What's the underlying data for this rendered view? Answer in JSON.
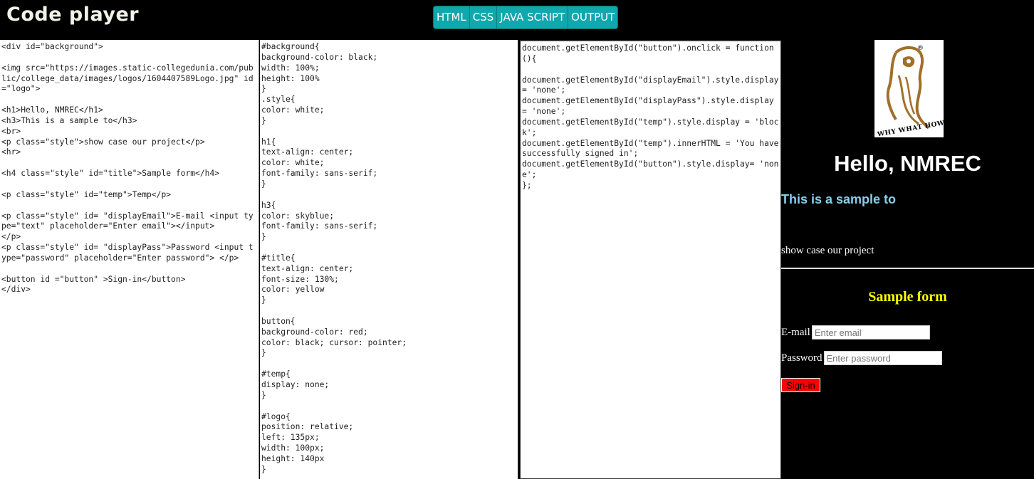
{
  "app": {
    "title": "Code player"
  },
  "tabs": [
    {
      "label": "HTML"
    },
    {
      "label": "CSS"
    },
    {
      "label": "JAVA SCRIPT"
    },
    {
      "label": "OUTPUT"
    }
  ],
  "editors": {
    "html": "<div id=\"background\">\n\n<img src=\"https://images.static-collegedunia.com/public/college_data/images/logos/1604407589Logo.jpg\" id=\"logo\">\n\n<h1>Hello, NMREC</h1>\n<h3>This is a sample to</h3>\n<br>\n<p class=\"style\">show case our project</p>\n<hr>\n\n<h4 class=\"style\" id=\"title\">Sample form</h4>\n\n<p class=\"style\" id=\"temp\">Temp</p>\n\n<p class=\"style\" id= \"displayEmail\">E-mail <input type=\"text\" placeholder=\"Enter email\"></input>\n</p>\n<p class=\"style\" id= \"displayPass\">Password <input type=\"password\" placeholder=\"Enter password\"> </p>\n\n<button id =\"button\" >Sign-in</button>\n</div>",
    "css": "#background{\nbackground-color: black;\nwidth: 100%;\nheight: 100%\n}\n.style{\ncolor: white;\n}\n\nh1{\ntext-align: center;\ncolor: white;\nfont-family: sans-serif;\n}\n\nh3{\ncolor: skyblue;\nfont-family: sans-serif;\n}\n\n#title{\ntext-align: center;\nfont-size: 130%;\ncolor: yellow\n}\n\nbutton{\nbackground-color: red;\ncolor: black; cursor: pointer;\n}\n\n#temp{\ndisplay: none;\n}\n\n#logo{\nposition: relative;\nleft: 135px;\nwidth: 100px;\nheight: 140px\n}",
    "js": "document.getElementById(\"button\").onclick = function(){\n\ndocument.getElementById(\"displayEmail\").style.display = 'none';\ndocument.getElementById(\"displayPass\").style.display = 'none';\ndocument.getElementById(\"temp\").style.display = 'block';\ndocument.getElementById(\"temp\").innerHTML = 'You have successfully signed in';\ndocument.getElementById(\"button\").style.display= 'none';\n};"
  },
  "output": {
    "logo_text": "WHY WHAT HOW",
    "logo_mark": "®",
    "h1": "Hello, NMREC",
    "h3": "This is a sample to",
    "showcase": "show case our project",
    "form_title": "Sample form",
    "email_label": "E-mail",
    "email_placeholder": "Enter email",
    "password_label": "Password",
    "password_placeholder": "Enter password",
    "signin_label": "Sign-in"
  },
  "colors": {
    "tab_bg": "#10a7ad",
    "h3": "#87ceeb",
    "form_title": "#ffff00",
    "button": "#ff0000",
    "logo_brown": "#a0702a"
  }
}
